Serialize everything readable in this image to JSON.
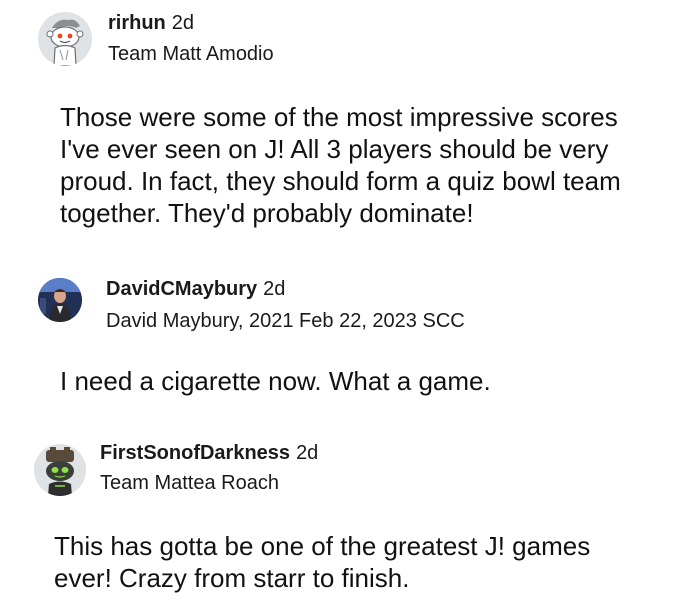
{
  "comments": [
    {
      "username": "rirhun",
      "age": "2d",
      "flair": "Team Matt Amodio",
      "avatar_icon": "snoo-avatar-icon",
      "body_lines": [
        "Those were some of the most impressive scores",
        "I've ever seen on J! All 3 players should be very",
        "proud. In fact, they should form a quiz bowl team",
        "together. They'd probably dominate!"
      ]
    },
    {
      "username": "DavidCMaybury",
      "age": "2d",
      "flair": "David Maybury, 2021 Feb 22, 2023 SCC",
      "avatar_icon": "person-photo-avatar-icon",
      "body_lines": [
        "I need a cigarette now. What a game."
      ]
    },
    {
      "username": "FirstSonofDarkness",
      "age": "2d",
      "flair": "Team Mattea Roach",
      "avatar_icon": "robot-avatar-icon",
      "body_lines": [
        "This has gotta be one of the greatest J! games",
        "ever! Crazy from starr to finish."
      ]
    }
  ],
  "colors": {
    "text": "#1a1a1b",
    "background": "#ffffff"
  }
}
